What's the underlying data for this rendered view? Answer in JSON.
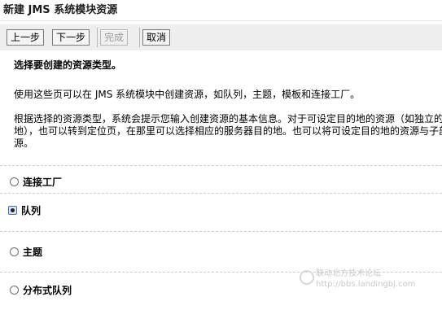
{
  "window": {
    "title": "新建 JMS 系统模块资源"
  },
  "toolbar": {
    "back_label": "上一步",
    "next_label": "下一步",
    "finish_label": "完成",
    "cancel_label": "取消"
  },
  "main": {
    "heading": "选择要创建的资源类型。",
    "para1": "使用这些页可以在 JMS 系统模块中创建资源，如队列，主题，模板和连接工厂。",
    "para2_lines": [
      "根据选择的资源类型，系统会提示您输入创建资源的基本信息。对于可设定目的地的资源（如独立的队",
      "地），也可以转到定位页，在那里可以选择相应的服务器目的地。也可以将可设定目的地的资源与子部",
      "源。"
    ]
  },
  "options": [
    {
      "label": "连接工厂",
      "checked": false
    },
    {
      "label": "队列",
      "checked": true
    },
    {
      "label": "主题",
      "checked": false
    },
    {
      "label": "分布式队列",
      "checked": false
    }
  ],
  "watermark": {
    "line1": "联动北方技术论坛",
    "line2": "http://bbs.landingbj.com"
  }
}
